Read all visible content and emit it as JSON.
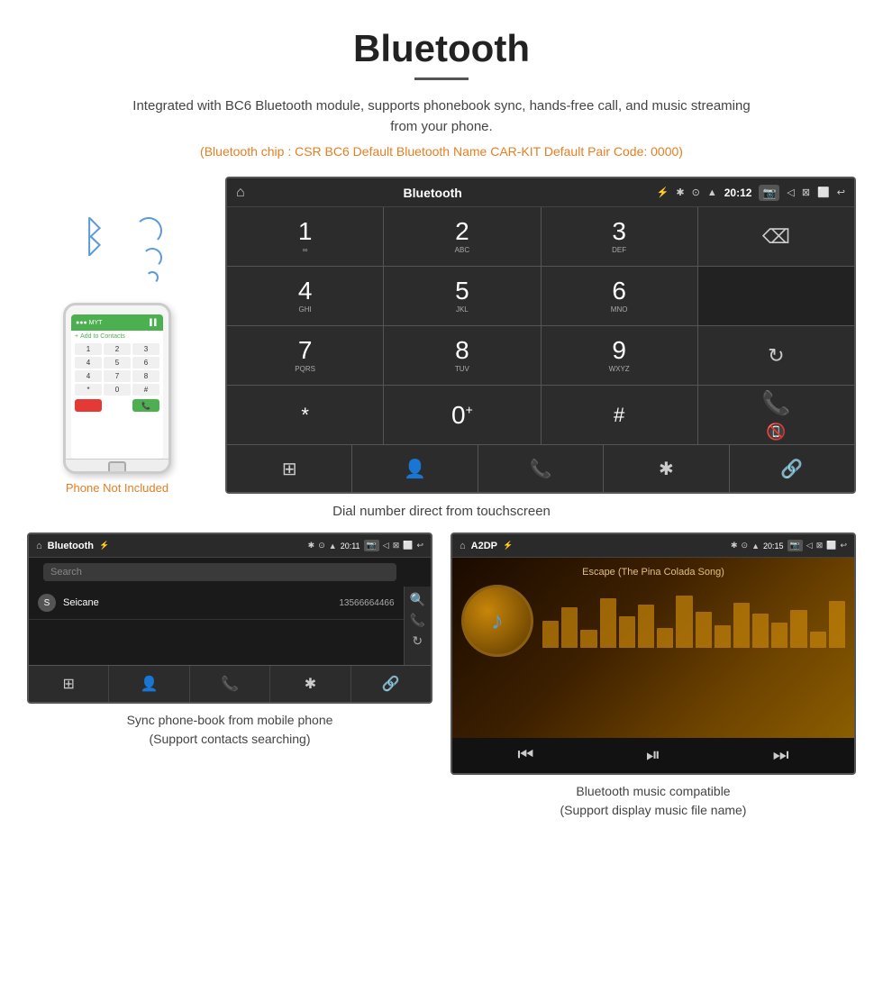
{
  "header": {
    "title": "Bluetooth",
    "underline": true,
    "description": "Integrated with BC6 Bluetooth module, supports phonebook sync, hands-free call, and music streaming from your phone.",
    "specs": "(Bluetooth chip : CSR BC6    Default Bluetooth Name CAR-KIT    Default Pair Code: 0000)"
  },
  "phone": {
    "not_included_label": "Phone Not Included"
  },
  "car_screen": {
    "status": {
      "home_icon": "⌂",
      "title": "Bluetooth",
      "usb_icon": "⚡",
      "bt_icon": "✱",
      "location_icon": "⊙",
      "signal_icon": "▲",
      "time": "20:12",
      "camera_icon": "📷",
      "volume_icon": "◁",
      "window_icon": "⊠",
      "fullscreen_icon": "⬜",
      "back_icon": "↩"
    },
    "keypad": [
      {
        "number": "1",
        "letters": "∞",
        "type": "digit"
      },
      {
        "number": "2",
        "letters": "ABC",
        "type": "digit"
      },
      {
        "number": "3",
        "letters": "DEF",
        "type": "digit"
      },
      {
        "number": "",
        "letters": "",
        "type": "backspace"
      },
      {
        "number": "4",
        "letters": "GHI",
        "type": "digit"
      },
      {
        "number": "5",
        "letters": "JKL",
        "type": "digit"
      },
      {
        "number": "6",
        "letters": "MNO",
        "type": "digit"
      },
      {
        "number": "",
        "letters": "",
        "type": "empty"
      },
      {
        "number": "7",
        "letters": "PQRS",
        "type": "digit"
      },
      {
        "number": "8",
        "letters": "TUV",
        "type": "digit"
      },
      {
        "number": "9",
        "letters": "WXYZ",
        "type": "digit"
      },
      {
        "number": "",
        "letters": "",
        "type": "refresh"
      },
      {
        "number": "*",
        "letters": "",
        "type": "symbol"
      },
      {
        "number": "0",
        "letters": "+",
        "type": "digit_plus"
      },
      {
        "number": "#",
        "letters": "",
        "type": "symbol"
      },
      {
        "number": "",
        "letters": "",
        "type": "call_split"
      }
    ],
    "toolbar": {
      "items": [
        {
          "icon": "⊞",
          "name": "grid"
        },
        {
          "icon": "👤",
          "name": "contact"
        },
        {
          "icon": "📞",
          "name": "phone"
        },
        {
          "icon": "✱",
          "name": "bluetooth"
        },
        {
          "icon": "🔗",
          "name": "link"
        }
      ]
    },
    "caption": "Dial number direct from touchscreen"
  },
  "phonebook_screen": {
    "status": {
      "home_icon": "⌂",
      "title": "Bluetooth",
      "usb_icon": "⚡",
      "bt_icon": "✱",
      "location_icon": "⊙",
      "signal_icon": "▲",
      "time": "20:11",
      "camera_icon": "📷",
      "volume_icon": "◁",
      "window_icon": "⊠",
      "fullscreen_icon": "⬜",
      "back_icon": "↩"
    },
    "search_placeholder": "Search",
    "contacts": [
      {
        "letter": "S",
        "name": "Seicane",
        "number": "13566664466"
      }
    ],
    "side_icons": [
      "🔍",
      "📞",
      "🔄"
    ],
    "toolbar": {
      "items": [
        {
          "icon": "⊞",
          "name": "grid"
        },
        {
          "icon": "👤",
          "name": "contact"
        },
        {
          "icon": "📞",
          "name": "phone"
        },
        {
          "icon": "✱",
          "name": "bluetooth"
        },
        {
          "icon": "🔗",
          "name": "link"
        }
      ]
    },
    "caption_line1": "Sync phone-book from mobile phone",
    "caption_line2": "(Support contacts searching)"
  },
  "music_screen": {
    "status": {
      "home_icon": "⌂",
      "title": "A2DP",
      "usb_icon": "⚡",
      "bt_icon": "✱",
      "location_icon": "⊙",
      "signal_icon": "▲",
      "time": "20:15",
      "camera_icon": "📷",
      "volume_icon": "◁",
      "window_icon": "⊠",
      "fullscreen_icon": "⬜",
      "back_icon": "↩"
    },
    "song_title": "Escape (The Pina Colada Song)",
    "visualizer_bars": [
      30,
      45,
      20,
      55,
      35,
      48,
      22,
      58,
      40,
      25,
      50,
      38,
      28,
      42,
      18,
      52
    ],
    "controls": [
      "⏮",
      "⏯",
      "⏭"
    ],
    "caption_line1": "Bluetooth music compatible",
    "caption_line2": "(Support display music file name)"
  }
}
